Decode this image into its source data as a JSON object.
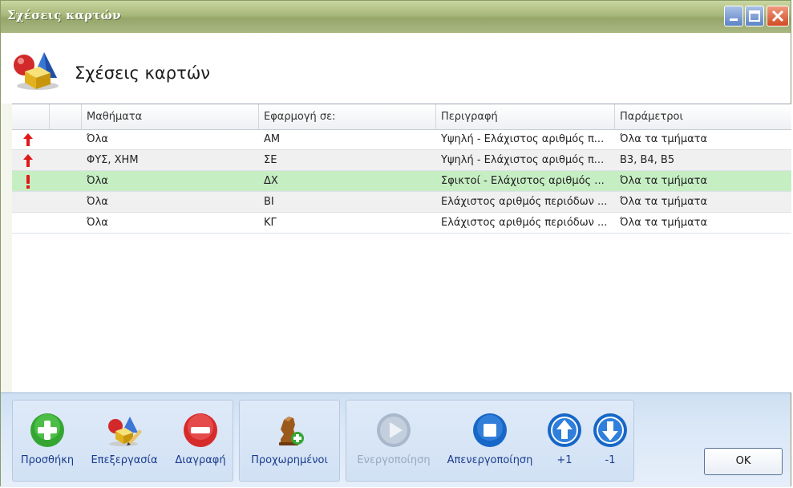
{
  "window": {
    "title": "Σχέσεις καρτών"
  },
  "header": {
    "title": "Σχέσεις καρτών"
  },
  "grid": {
    "columns": [
      "",
      "Μαθήματα",
      "Εφαρμογή σε:",
      "Περιγραφή",
      "Παράμετροι"
    ],
    "rows": [
      {
        "indicator": "up-arrow",
        "subjects": "Όλα",
        "applies_to": "ΑΜ",
        "description": "Υψηλή - Ελάχιστος αριθμός π...",
        "parameters": "Όλα τα τμήματα",
        "state": "normal"
      },
      {
        "indicator": "up-arrow",
        "subjects": "ΦΥΣ, ΧΗΜ",
        "applies_to": "ΣΕ",
        "description": "Υψηλή - Ελάχιστος αριθμός π...",
        "parameters": "Β3, Β4, Β5",
        "state": "alt"
      },
      {
        "indicator": "exclamation",
        "subjects": "Όλα",
        "applies_to": "ΔΧ",
        "description": "Σφικτοί - Ελάχιστος αριθμός ...",
        "parameters": "Όλα τα τμήματα",
        "state": "selected"
      },
      {
        "indicator": "",
        "subjects": "Όλα",
        "applies_to": "ΒΙ",
        "description": "Ελάχιστος αριθμός περιόδων ...",
        "parameters": "Όλα τα τμήματα",
        "state": "alt"
      },
      {
        "indicator": "",
        "subjects": "Όλα",
        "applies_to": "ΚΓ",
        "description": "Ελάχιστος αριθμός περιόδων ...",
        "parameters": "Όλα τα τμήματα",
        "state": "normal"
      }
    ]
  },
  "toolbar": {
    "add": "Προσθήκη",
    "edit": "Επεξεργασία",
    "delete": "Διαγραφή",
    "advanced": "Προχωρημένοι",
    "activate": "Ενεργοποίηση",
    "deactivate": "Απενεργοποίηση",
    "up": "+1",
    "down": "-1"
  },
  "ok_label": "OK",
  "colors": {
    "indicator_red": "#e01818",
    "selected_row": "#c6eec3",
    "link_blue": "#1a3b8c"
  }
}
